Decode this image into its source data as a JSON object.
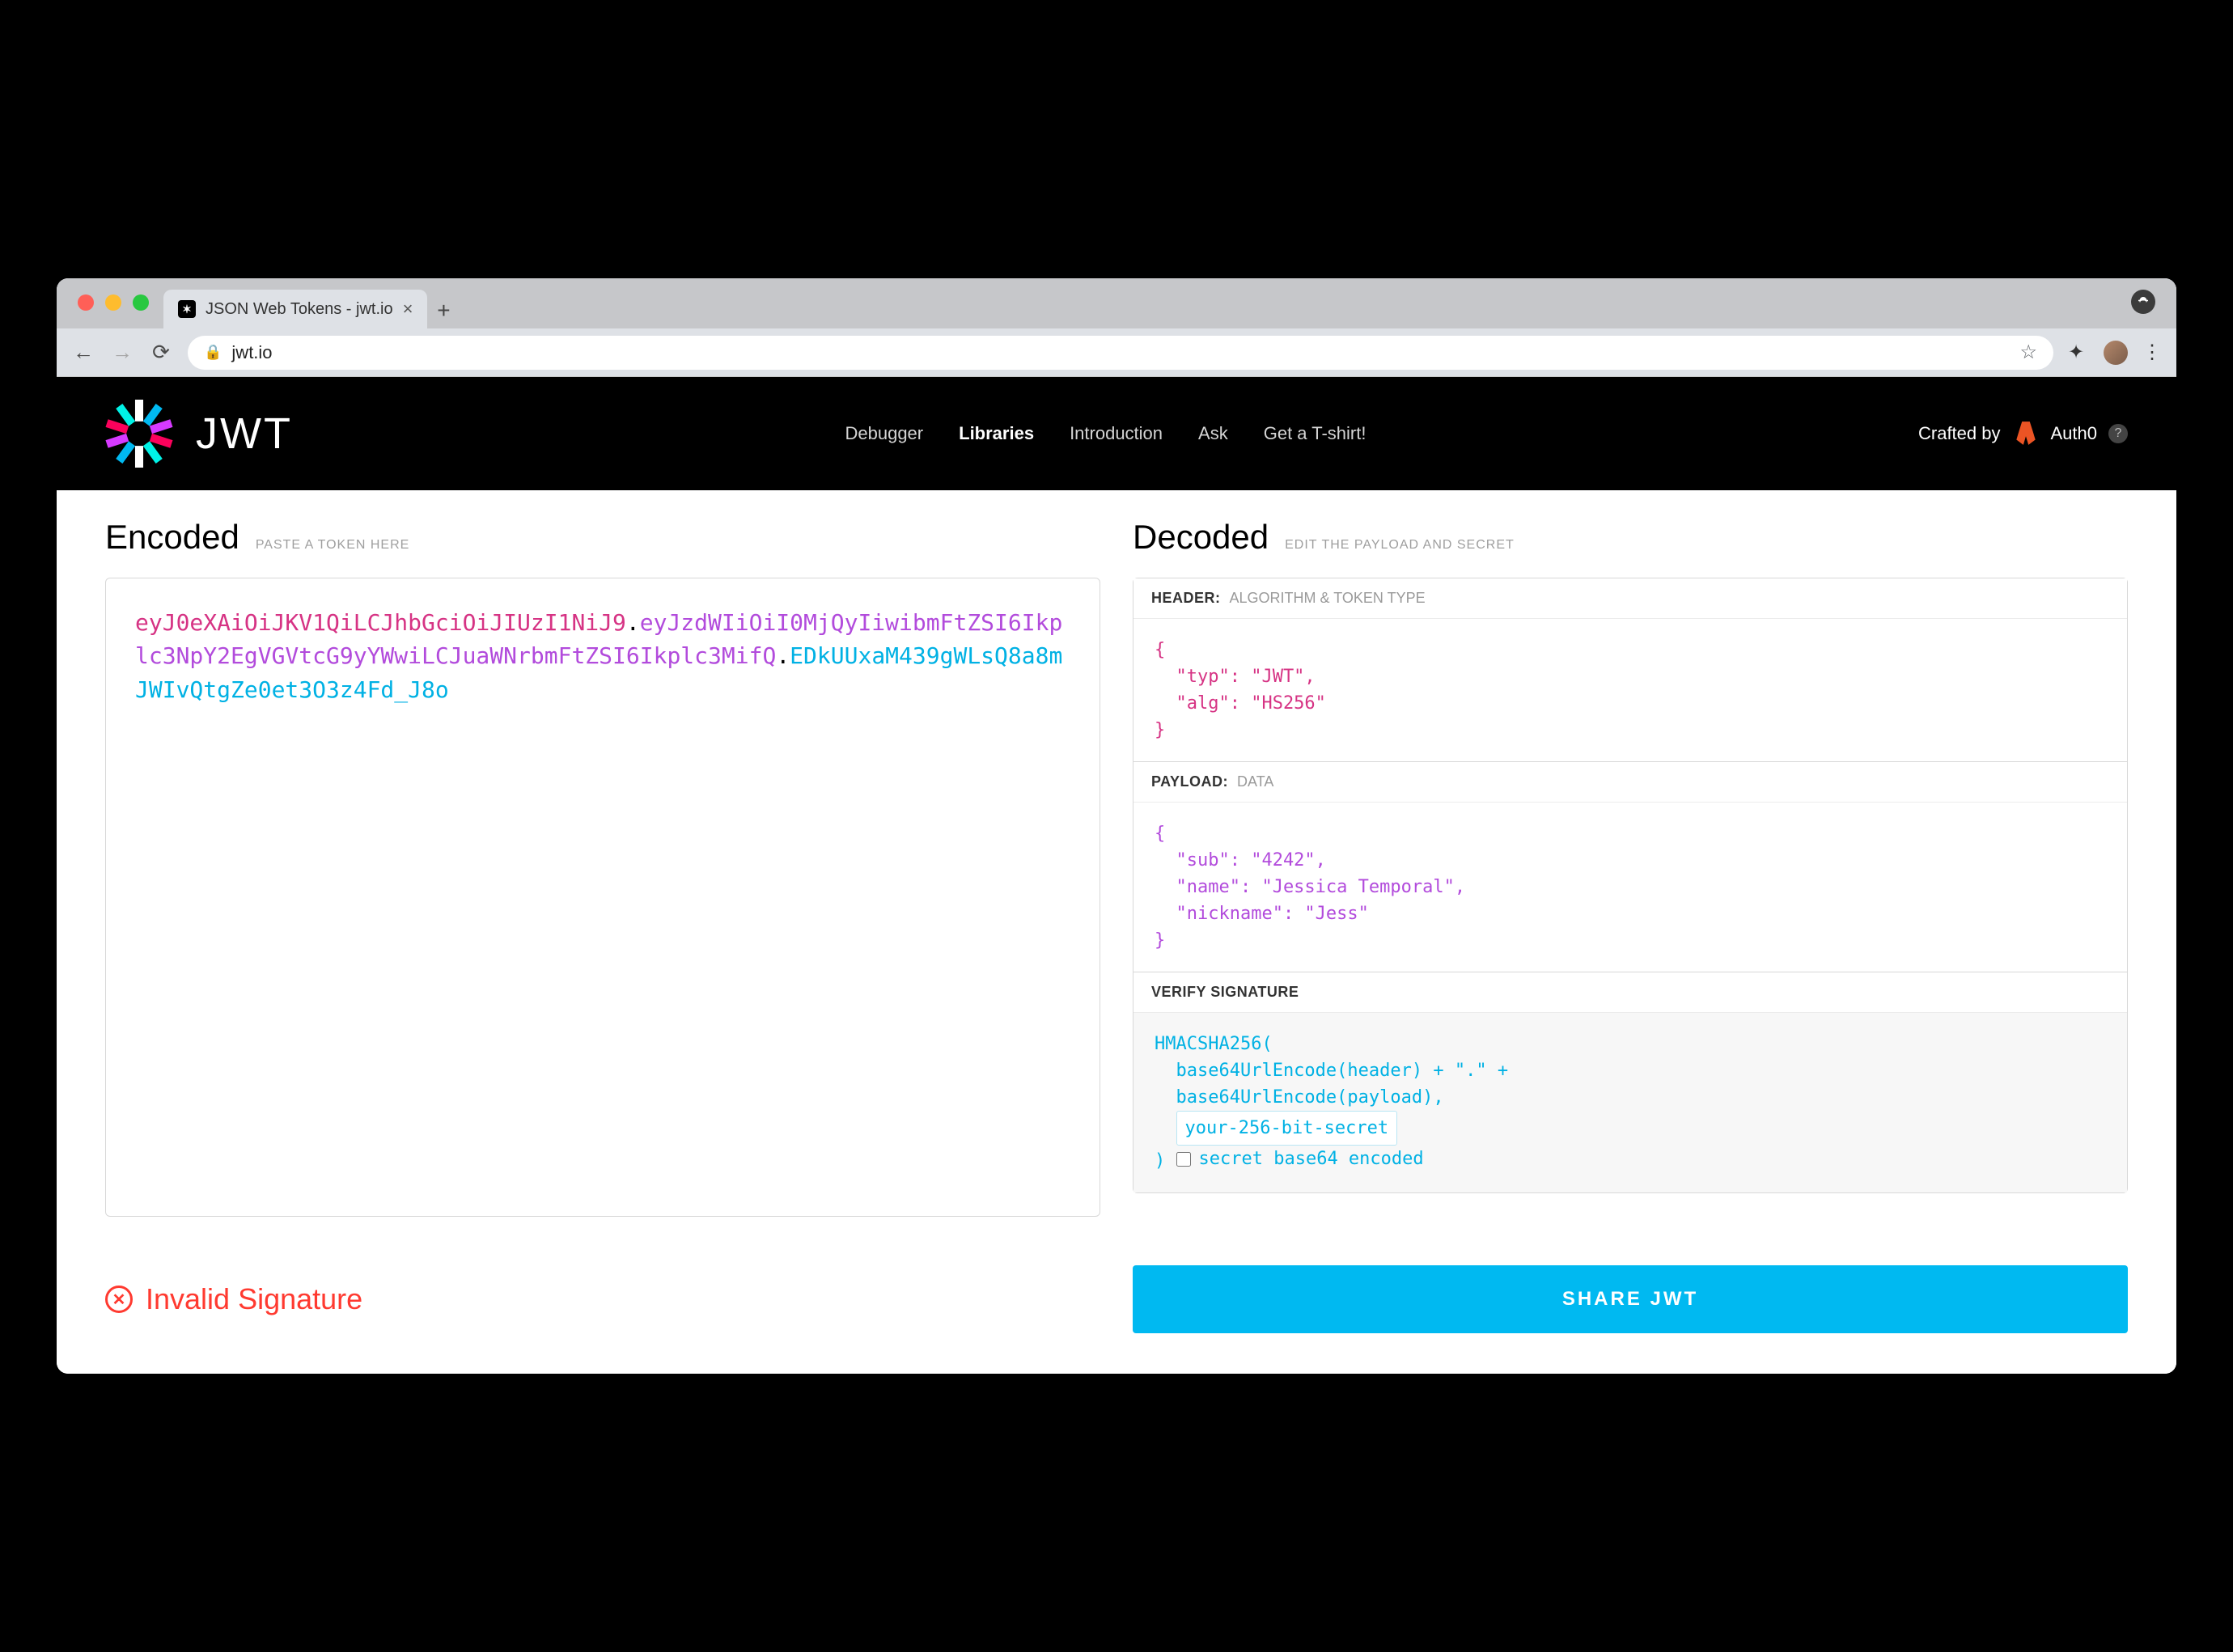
{
  "browser": {
    "tab_title": "JSON Web Tokens - jwt.io",
    "url": "jwt.io"
  },
  "header": {
    "logo_text": "JWT",
    "menu": {
      "debugger": "Debugger",
      "libraries": "Libraries",
      "introduction": "Introduction",
      "ask": "Ask",
      "tshirt": "Get a T-shirt!"
    },
    "crafted_by": "Crafted by",
    "crafted_brand": "Auth0"
  },
  "encoded": {
    "title": "Encoded",
    "hint": "PASTE A TOKEN HERE",
    "token": {
      "header": "eyJ0eXAiOiJKV1QiLCJhbGciOiJIUzI1NiJ9",
      "payload": "eyJzdWIiOiI0MjQyIiwibmFtZSI6Ikplc3NpY2EgVGVtcG9yYWwiLCJuaWNrbmFtZSI6Ikplc3MifQ",
      "signature": "EDkUUxaM439gWLsQ8a8mJWIvQtgZe0et3O3z4Fd_J8o"
    }
  },
  "decoded": {
    "title": "Decoded",
    "hint": "EDIT THE PAYLOAD AND SECRET",
    "header_section": {
      "label": "HEADER:",
      "sub": "ALGORITHM & TOKEN TYPE",
      "json": "{\n  \"typ\": \"JWT\",\n  \"alg\": \"HS256\"\n}"
    },
    "payload_section": {
      "label": "PAYLOAD:",
      "sub": "DATA",
      "json": "{\n  \"sub\": \"4242\",\n  \"name\": \"Jessica Temporal\",\n  \"nickname\": \"Jess\"\n}"
    },
    "signature_section": {
      "label": "VERIFY SIGNATURE",
      "algo": "HMACSHA256(",
      "line1": "  base64UrlEncode(header) + \".\" +",
      "line2": "  base64UrlEncode(payload),",
      "secret_value": "your-256-bit-secret",
      "close": ")",
      "b64_label": "secret base64 encoded"
    }
  },
  "status": {
    "text": "Invalid Signature"
  },
  "share": {
    "label": "SHARE JWT"
  }
}
